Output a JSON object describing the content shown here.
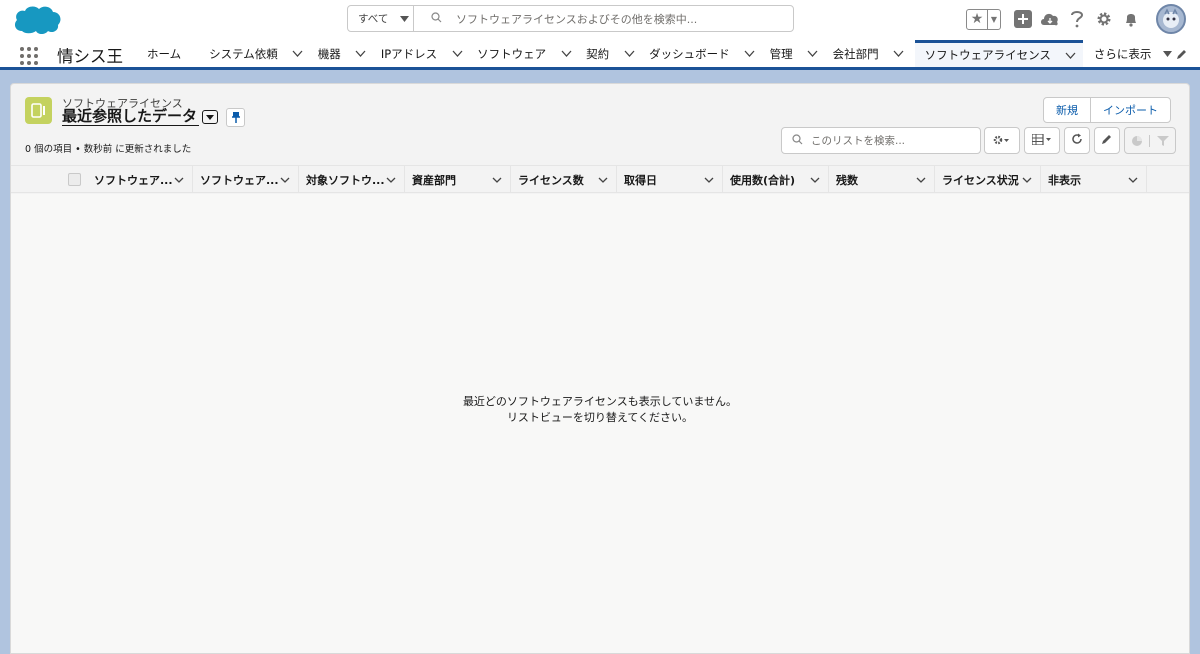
{
  "header": {
    "search_scope": "すべて",
    "search_placeholder": "ソフトウェアライセンスおよびその他を検索中..."
  },
  "nav": {
    "app_name": "情シス王",
    "items": [
      {
        "label": "ホーム"
      },
      {
        "label": "システム依頼"
      },
      {
        "label": "機器"
      },
      {
        "label": "IPアドレス"
      },
      {
        "label": "ソフトウェア"
      },
      {
        "label": "契約"
      },
      {
        "label": "ダッシュボード"
      },
      {
        "label": "管理"
      },
      {
        "label": "会社部門"
      },
      {
        "label": "ソフトウェアライセンス"
      }
    ],
    "more_label": "さらに表示"
  },
  "list_view": {
    "object_label": "ソフトウェアライセンス",
    "view_name": "最近参照したデータ",
    "info": "0 個の項目 • 数秒前 に更新されました",
    "new_button": "新規",
    "import_button": "インポート",
    "search_placeholder": "このリストを検索...",
    "columns": [
      {
        "label": "ソフトウェア..."
      },
      {
        "label": "ソフトウェア..."
      },
      {
        "label": "対象ソフトウ..."
      },
      {
        "label": "資産部門"
      },
      {
        "label": "ライセンス数"
      },
      {
        "label": "取得日"
      },
      {
        "label": "使用数(合計)"
      },
      {
        "label": "残数"
      },
      {
        "label": "ライセンス状況"
      },
      {
        "label": "非表示"
      }
    ],
    "empty_line1": "最近どのソフトウェアライセンスも表示していません。",
    "empty_line2": "リストビューを切り替えてください。"
  },
  "colors": {
    "brand_blue": "#1b5297",
    "link_blue": "#0b5cab",
    "object_icon": "#c4d25f",
    "salesforce_cloud": "#1798c1"
  }
}
